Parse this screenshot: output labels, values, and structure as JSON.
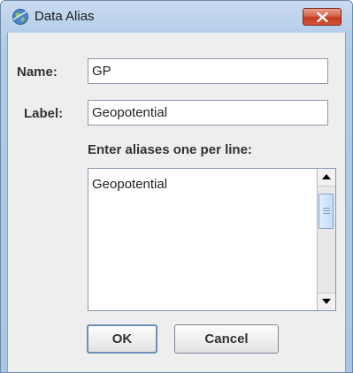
{
  "window": {
    "title": "Data Alias"
  },
  "form": {
    "name_label": "Name:",
    "name_value": "GP",
    "label_label": "Label:",
    "label_value": "Geopotential",
    "aliases_prompt": "Enter aliases one per line:",
    "aliases_text": "Geopotential"
  },
  "buttons": {
    "ok": "OK",
    "cancel": "Cancel"
  },
  "icons": {
    "app": "globe-icon",
    "close": "close-icon",
    "scroll_up": "chevron-up-icon",
    "scroll_down": "chevron-down-icon"
  },
  "colors": {
    "frame": "#b8d0ea",
    "close_button": "#c33a1e",
    "client_bg": "#eeeeee"
  }
}
